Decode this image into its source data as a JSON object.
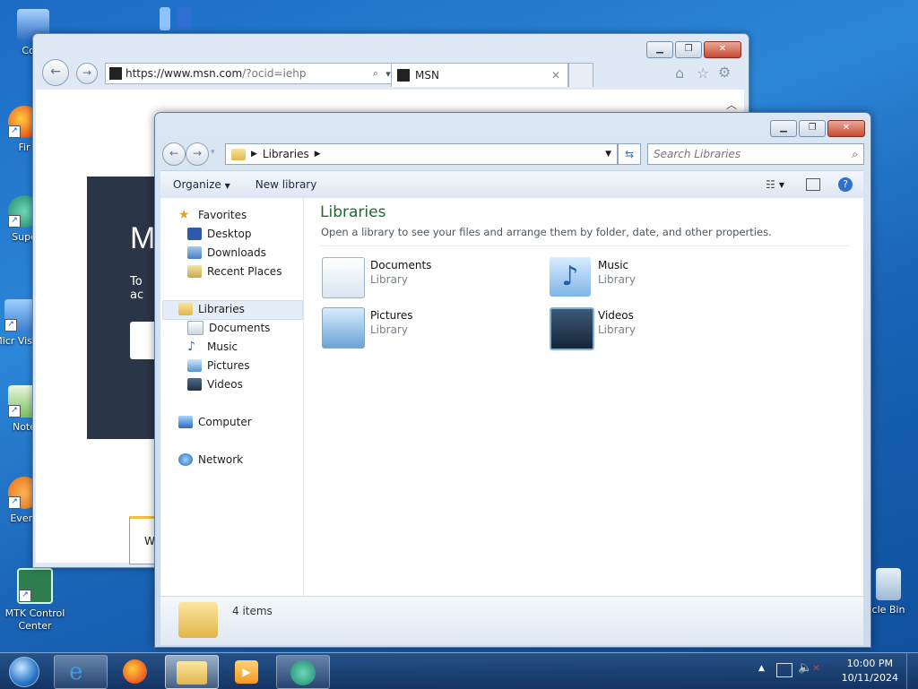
{
  "desktop": {
    "icons": [
      {
        "label": "Com"
      },
      {
        "label": "Fir"
      },
      {
        "label": "Supe"
      },
      {
        "label": "Micr Visual"
      },
      {
        "label": "Note"
      },
      {
        "label": "Every"
      },
      {
        "label": "MTK Control Center"
      },
      {
        "label": "cle Bin"
      }
    ]
  },
  "ie": {
    "url_main": "https://www.msn.com",
    "url_rest": "/?ocid=iehp",
    "tab_title": "MSN",
    "page_heading_fragment": "M",
    "page_text_fragment": "To ac",
    "banner_fragment": "W"
  },
  "explorer": {
    "breadcrumb": "Libraries",
    "search_placeholder": "Search Libraries",
    "toolbar": {
      "organize": "Organize",
      "new_library": "New library"
    },
    "nav": {
      "favorites": "Favorites",
      "desktop": "Desktop",
      "downloads": "Downloads",
      "recent_places": "Recent Places",
      "libraries": "Libraries",
      "documents": "Documents",
      "music": "Music",
      "pictures": "Pictures",
      "videos": "Videos",
      "computer": "Computer",
      "network": "Network"
    },
    "content": {
      "title": "Libraries",
      "description": "Open a library to see your files and arrange them by folder, date, and other properties.",
      "items": [
        {
          "name": "Documents",
          "type": "Library"
        },
        {
          "name": "Music",
          "type": "Library"
        },
        {
          "name": "Pictures",
          "type": "Library"
        },
        {
          "name": "Videos",
          "type": "Library"
        }
      ]
    },
    "status": {
      "count": "4 items"
    }
  },
  "taskbar": {
    "time": "10:00 PM",
    "date": "10/11/2024"
  }
}
